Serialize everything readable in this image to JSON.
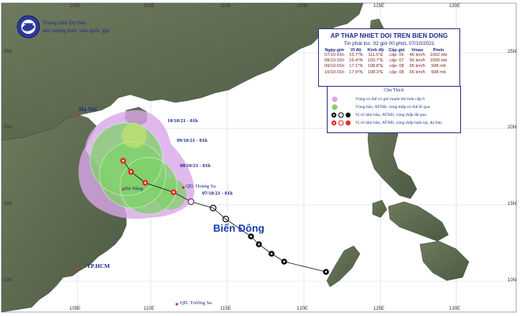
{
  "header": {
    "agency_line1": "Trung tâm Dự báo",
    "agency_line2": "khí tượng thủy văn quốc gia"
  },
  "info_box": {
    "title": "AP THAP NHIET DOI TREN BIEN DONG",
    "issued": "Tin phát lúc: 02 giờ 00 phút, 07/10/2021",
    "columns": [
      "Ngày-giờ",
      "Vĩ độ",
      "Kinh độ",
      "Cấp gió",
      "Vmax",
      "Pmin"
    ],
    "rows": [
      [
        "07/10-01h",
        "15.7°N",
        "111.5°E",
        "cấp: 06",
        "46 km/h",
        "1002 mb"
      ],
      [
        "08/10-01h",
        "16.4°N",
        "109.7°E",
        "cấp: 07",
        "56 km/h",
        "1000 mb"
      ],
      [
        "09/10-01h",
        "17.1°N",
        "108.8°E",
        "cấp: 08",
        "65 km/h",
        "998 mb"
      ],
      [
        "10/10-01h",
        "17.9°N",
        "108.3°E",
        "cấp: 08",
        "65 km/h",
        "998 mb"
      ]
    ]
  },
  "legend": {
    "title": "Chú Thích",
    "items": [
      {
        "symbol": "purple-circle-icon",
        "text": "Vùng có thể có gió mạnh lên hơn cấp 6"
      },
      {
        "symbol": "green-circle-icon",
        "text": "Vùng bão, ATNĐ, vùng thấp có thể đi qua"
      },
      {
        "symbol": "black-storm-icons",
        "text": "Vị trí tâm bão, ATNĐ, vùng thấp đã qua"
      },
      {
        "symbol": "red-storm-icons",
        "text": "Vị trí tâm bão, ATNĐ, vùng thấp hiện tại, dự báo"
      }
    ]
  },
  "map_labels": {
    "ha_noi": "Hà Nội",
    "da_nang": "Đà Nẵng",
    "tp_hcm": "TP.HCM",
    "hoang_sa": "QĐ. Hoàng Sa",
    "truong_sa": "QĐ. Trường Sa",
    "bien_dong": "Biển Đông",
    "f1": "10/10/21 - 01h",
    "f2": "09/10/21 - 01h",
    "f3": "08/10/21 - 01h",
    "f4": "07/10/21 - 01h"
  },
  "axes": {
    "lon_ticks": [
      "105E",
      "110E",
      "115E",
      "120E",
      "125E",
      "130E"
    ],
    "lat_ticks": [
      "25N",
      "20N",
      "15N",
      "10N"
    ]
  },
  "colors": {
    "sea": "#ffffff",
    "land": "#5f6b52",
    "purple_zone": "#d9a6e8",
    "green_zone": "#7fd16a",
    "track_black": "#111111",
    "track_red": "#e0312a"
  }
}
